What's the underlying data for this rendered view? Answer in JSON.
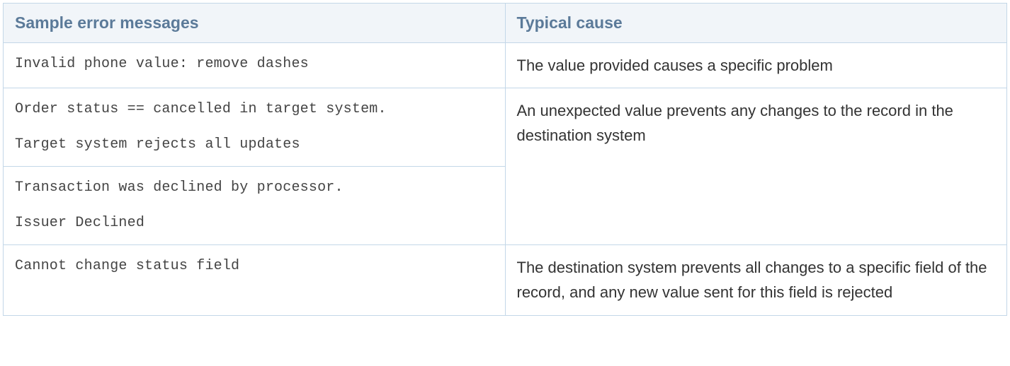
{
  "table": {
    "headers": {
      "error": "Sample error messages",
      "cause": "Typical cause"
    },
    "rows": [
      {
        "error_line1": "Invalid phone value: remove dashes",
        "error_line2": "",
        "cause": "The value provided causes a specific problem"
      },
      {
        "error_line1": "Order status == cancelled in target system.",
        "error_line2": "Target system rejects all updates",
        "cause": "An unexpected value prevents any changes to the record in the destination system"
      },
      {
        "error_line1": "Transaction was declined by processor.",
        "error_line2": "Issuer Declined",
        "cause": ""
      },
      {
        "error_line1": "Cannot change status field",
        "error_line2": "",
        "cause": "The destination system prevents all changes to a specific field of the record, and any new value sent for this field is rejected"
      }
    ]
  }
}
